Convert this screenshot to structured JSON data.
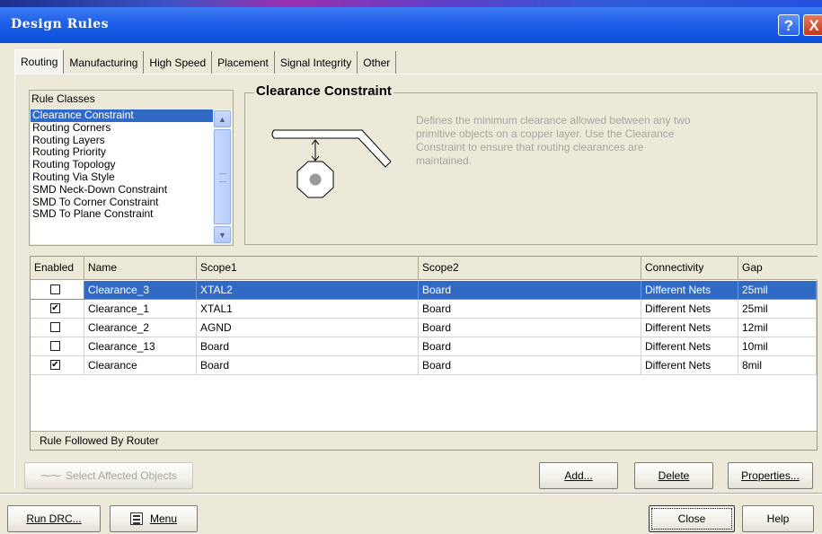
{
  "window": {
    "title": "Design Rules",
    "help_glyph": "?",
    "close_glyph": "X"
  },
  "tabs": [
    {
      "label": "Routing",
      "active": true
    },
    {
      "label": "Manufacturing",
      "active": false
    },
    {
      "label": "High Speed",
      "active": false
    },
    {
      "label": "Placement",
      "active": false
    },
    {
      "label": "Signal Integrity",
      "active": false
    },
    {
      "label": "Other",
      "active": false
    }
  ],
  "rule_classes": {
    "header": "Rule Classes",
    "items": [
      {
        "label": "Clearance Constraint",
        "selected": true
      },
      {
        "label": "Routing Corners",
        "selected": false
      },
      {
        "label": "Routing Layers",
        "selected": false
      },
      {
        "label": "Routing Priority",
        "selected": false
      },
      {
        "label": "Routing Topology",
        "selected": false
      },
      {
        "label": "Routing Via Style",
        "selected": false
      },
      {
        "label": "SMD Neck-Down Constraint",
        "selected": false
      },
      {
        "label": "SMD To Corner Constraint",
        "selected": false
      },
      {
        "label": "SMD To Plane Constraint",
        "selected": false
      }
    ]
  },
  "constraint": {
    "title": "Clearance Constraint",
    "description": "Defines the minimum clearance allowed between any two primitive objects on a copper layer. Use the Clearance Constraint to ensure that routing clearances are maintained."
  },
  "grid": {
    "columns": [
      "Enabled",
      "Name",
      "Scope1",
      "Scope2",
      "Connectivity",
      "Gap"
    ],
    "rows": [
      {
        "enabled": true,
        "name": "Clearance_3",
        "scope1": "XTAL2",
        "scope2": "Board",
        "connectivity": "Different Nets",
        "gap": "25mil",
        "selected": true
      },
      {
        "enabled": true,
        "name": "Clearance_1",
        "scope1": "XTAL1",
        "scope2": "Board",
        "connectivity": "Different Nets",
        "gap": "25mil",
        "selected": false
      },
      {
        "enabled": false,
        "name": "Clearance_2",
        "scope1": "AGND",
        "scope2": "Board",
        "connectivity": "Different Nets",
        "gap": "12mil",
        "selected": false
      },
      {
        "enabled": false,
        "name": "Clearance_13",
        "scope1": "Board",
        "scope2": "Board",
        "connectivity": "Different Nets",
        "gap": "10mil",
        "selected": false
      },
      {
        "enabled": true,
        "name": "Clearance",
        "scope1": "Board",
        "scope2": "Board",
        "connectivity": "Different Nets",
        "gap": "8mil",
        "selected": false
      }
    ],
    "footer": "Rule Followed By Router"
  },
  "buttons": {
    "select_affected": "Select Affected Objects",
    "add": "Add...",
    "delete": "Delete",
    "properties": "Properties...",
    "run_drc": "Run DRC...",
    "menu": "Menu",
    "close": "Close",
    "help": "Help"
  },
  "colors": {
    "titlebar": "#0b4fd8",
    "selection": "#316ac5",
    "dialog_bg": "#ece9d8"
  }
}
